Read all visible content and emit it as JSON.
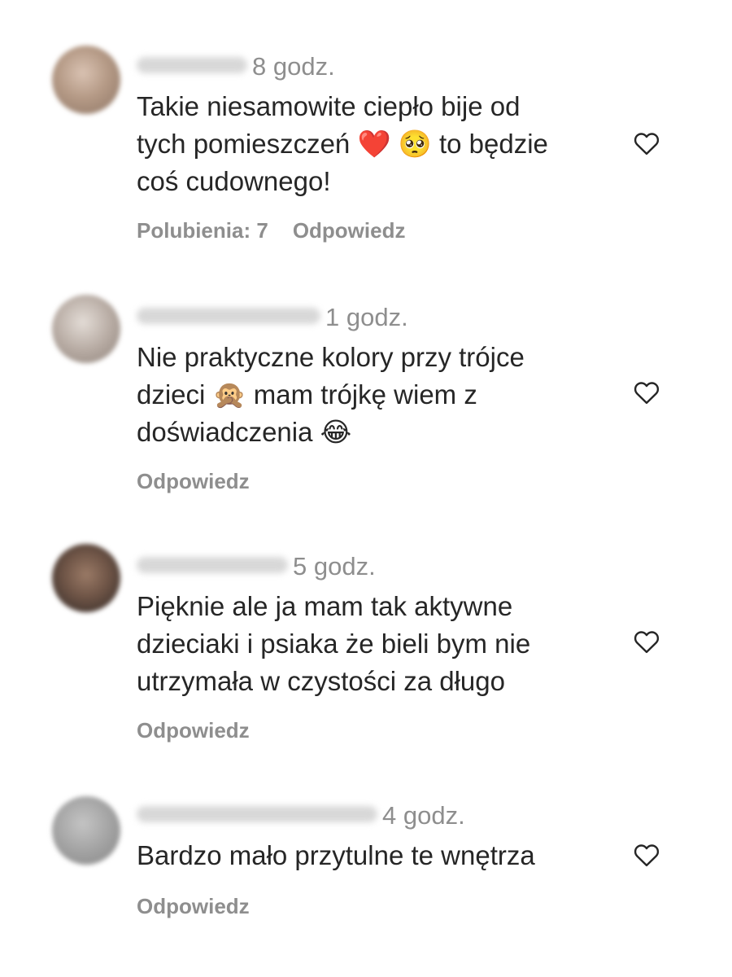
{
  "comments": [
    {
      "time": "8 godz.",
      "text": "Takie niesamowite ciepło bije od\ntych pomieszczeń ❤️ 🥺 to będzie\ncoś cudownego!",
      "likes_label": "Polubienia: 7",
      "reply_label": "Odpowiedz",
      "avatar_color": "#b59a86"
    },
    {
      "time": "1 godz.",
      "text": "Nie praktyczne kolory przy trójce\ndzieci 🙊 mam trójkę wiem z\ndoświadczenia 😂",
      "reply_label": "Odpowiedz",
      "avatar_color": "#b8aca4"
    },
    {
      "time": "5 godz.",
      "text": "Pięknie ale ja mam tak aktywne\ndzieciaki i psiaka że bieli bym nie\nutrzymała w czystości za długo",
      "reply_label": "Odpowiedz",
      "avatar_color": "#6e5446"
    },
    {
      "time": "4 godz.",
      "text": "Bardzo mało przytulne te wnętrza",
      "reply_label": "Odpowiedz",
      "avatar_color": "#a3a3a3"
    }
  ],
  "icons": {
    "like": "heart-outline-icon"
  },
  "colors": {
    "text": "#262626",
    "secondary": "#8e8e8e"
  }
}
